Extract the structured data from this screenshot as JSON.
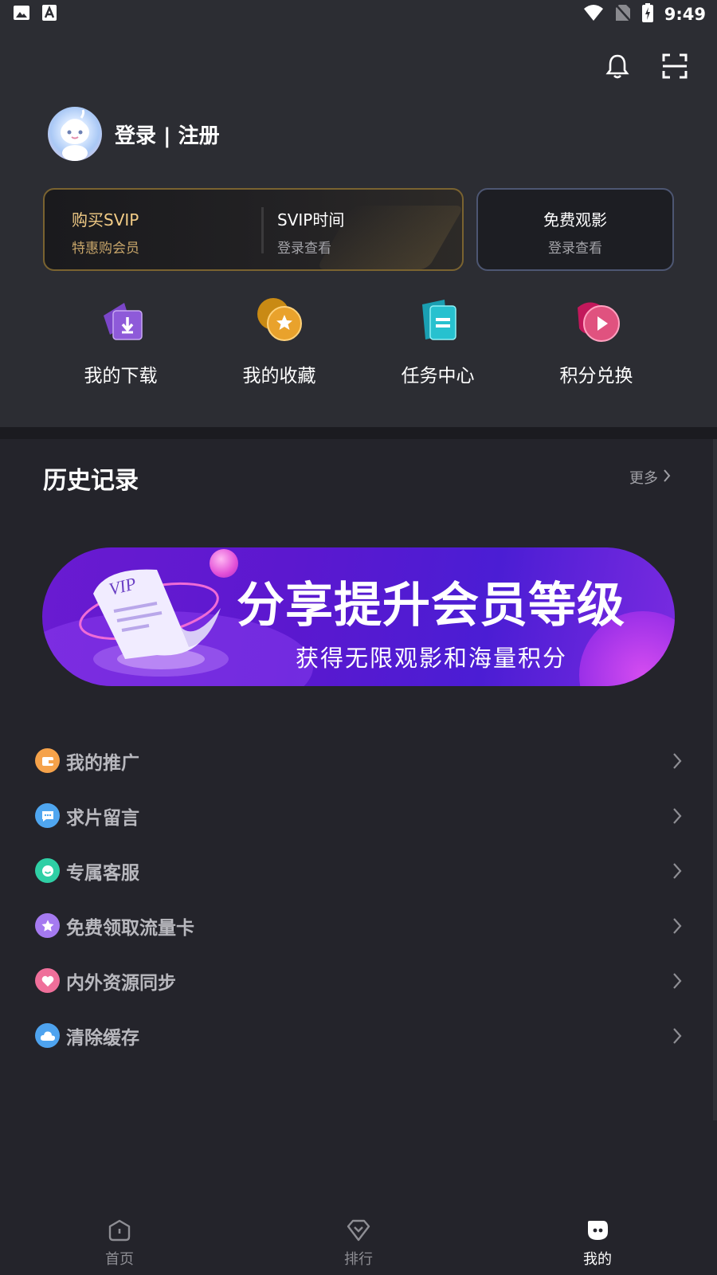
{
  "status_bar": {
    "time": "9:49"
  },
  "header": {
    "login_label": "登录 | 注册"
  },
  "vip_card": {
    "buy_title": "购买SVIP",
    "buy_sub": "特惠购会员",
    "time_title": "SVIP时间",
    "time_sub": "登录查看",
    "colors": {
      "gold": "#f2cc86",
      "gold_sub": "#c7a56a"
    }
  },
  "free_card": {
    "title": "免费观影",
    "sub": "登录查看"
  },
  "quick_actions": [
    {
      "label": "我的下载",
      "icon": "download-icon"
    },
    {
      "label": "我的收藏",
      "icon": "star-icon"
    },
    {
      "label": "任务中心",
      "icon": "task-icon"
    },
    {
      "label": "积分兑换",
      "icon": "play-icon"
    }
  ],
  "history": {
    "title": "历史记录",
    "more": "更多"
  },
  "banner": {
    "title": "分享提升会员等级",
    "subtitle": "获得无限观影和海量积分",
    "badge": "VIP"
  },
  "menu": [
    {
      "label": "我的推广",
      "icon": "promote-icon",
      "color": "#f5a24a"
    },
    {
      "label": "求片留言",
      "icon": "message-icon",
      "color": "#4fa6f0"
    },
    {
      "label": "专属客服",
      "icon": "service-icon",
      "color": "#2fcfa5"
    },
    {
      "label": "免费领取流量卡",
      "icon": "sim-card-icon",
      "color": "#a57af0"
    },
    {
      "label": "内外资源同步",
      "icon": "heart-icon",
      "color": "#ef6f9a"
    },
    {
      "label": "清除缓存",
      "icon": "cloud-icon",
      "color": "#4ea3ef"
    }
  ],
  "bottom_nav": [
    {
      "label": "首页",
      "icon": "home-icon",
      "active": false
    },
    {
      "label": "排行",
      "icon": "ranking-icon",
      "active": false
    },
    {
      "label": "我的",
      "icon": "profile-icon",
      "active": true
    }
  ]
}
